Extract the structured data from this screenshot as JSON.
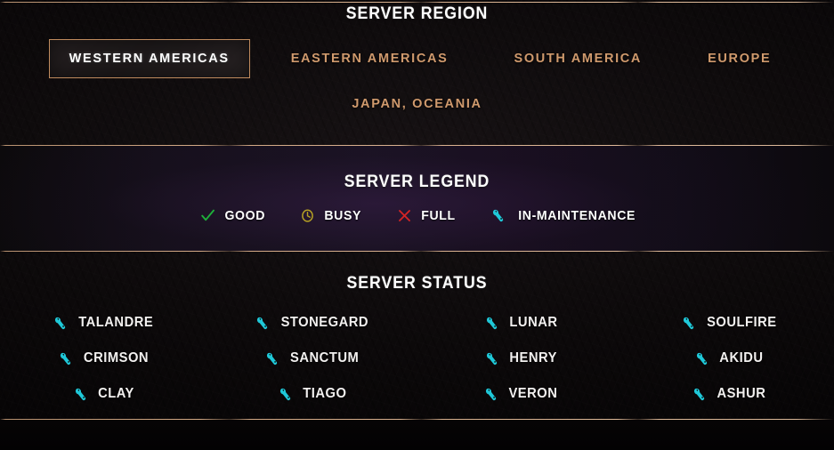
{
  "region": {
    "title": "SERVER REGION",
    "tabs": [
      {
        "label": "WESTERN AMERICAS",
        "selected": true
      },
      {
        "label": "EASTERN AMERICAS",
        "selected": false
      },
      {
        "label": "SOUTH AMERICA",
        "selected": false
      },
      {
        "label": "EUROPE",
        "selected": false
      },
      {
        "label": "JAPAN, OCEANIA",
        "selected": false
      }
    ]
  },
  "legend": {
    "title": "SERVER LEGEND",
    "items": [
      {
        "label": "GOOD",
        "icon": "check-icon",
        "color": "#1eb03a"
      },
      {
        "label": "BUSY",
        "icon": "clock-icon",
        "color": "#b5a024"
      },
      {
        "label": "FULL",
        "icon": "cross-icon",
        "color": "#d42424"
      },
      {
        "label": "IN-MAINTENANCE",
        "icon": "wrench-icon",
        "color": "#1fc8d8"
      }
    ]
  },
  "status": {
    "title": "SERVER STATUS",
    "servers": [
      {
        "name": "TALANDRE",
        "status": "in-maintenance",
        "icon": "wrench-icon"
      },
      {
        "name": "STONEGARD",
        "status": "in-maintenance",
        "icon": "wrench-icon"
      },
      {
        "name": "LUNAR",
        "status": "in-maintenance",
        "icon": "wrench-icon"
      },
      {
        "name": "SOULFIRE",
        "status": "in-maintenance",
        "icon": "wrench-icon"
      },
      {
        "name": "CRIMSON",
        "status": "in-maintenance",
        "icon": "wrench-icon"
      },
      {
        "name": "SANCTUM",
        "status": "in-maintenance",
        "icon": "wrench-icon"
      },
      {
        "name": "HENRY",
        "status": "in-maintenance",
        "icon": "wrench-icon"
      },
      {
        "name": "AKIDU",
        "status": "in-maintenance",
        "icon": "wrench-icon"
      },
      {
        "name": "CLAY",
        "status": "in-maintenance",
        "icon": "wrench-icon"
      },
      {
        "name": "TIAGO",
        "status": "in-maintenance",
        "icon": "wrench-icon"
      },
      {
        "name": "VERON",
        "status": "in-maintenance",
        "icon": "wrench-icon"
      },
      {
        "name": "ASHUR",
        "status": "in-maintenance",
        "icon": "wrench-icon"
      }
    ]
  },
  "theme": {
    "accent_bronze": "#d09a6d",
    "divider": "#e0b48c",
    "text_primary": "#ffffff",
    "maintenance_cyan": "#1fc8d8",
    "legend_band_bg": "#1b1324"
  }
}
